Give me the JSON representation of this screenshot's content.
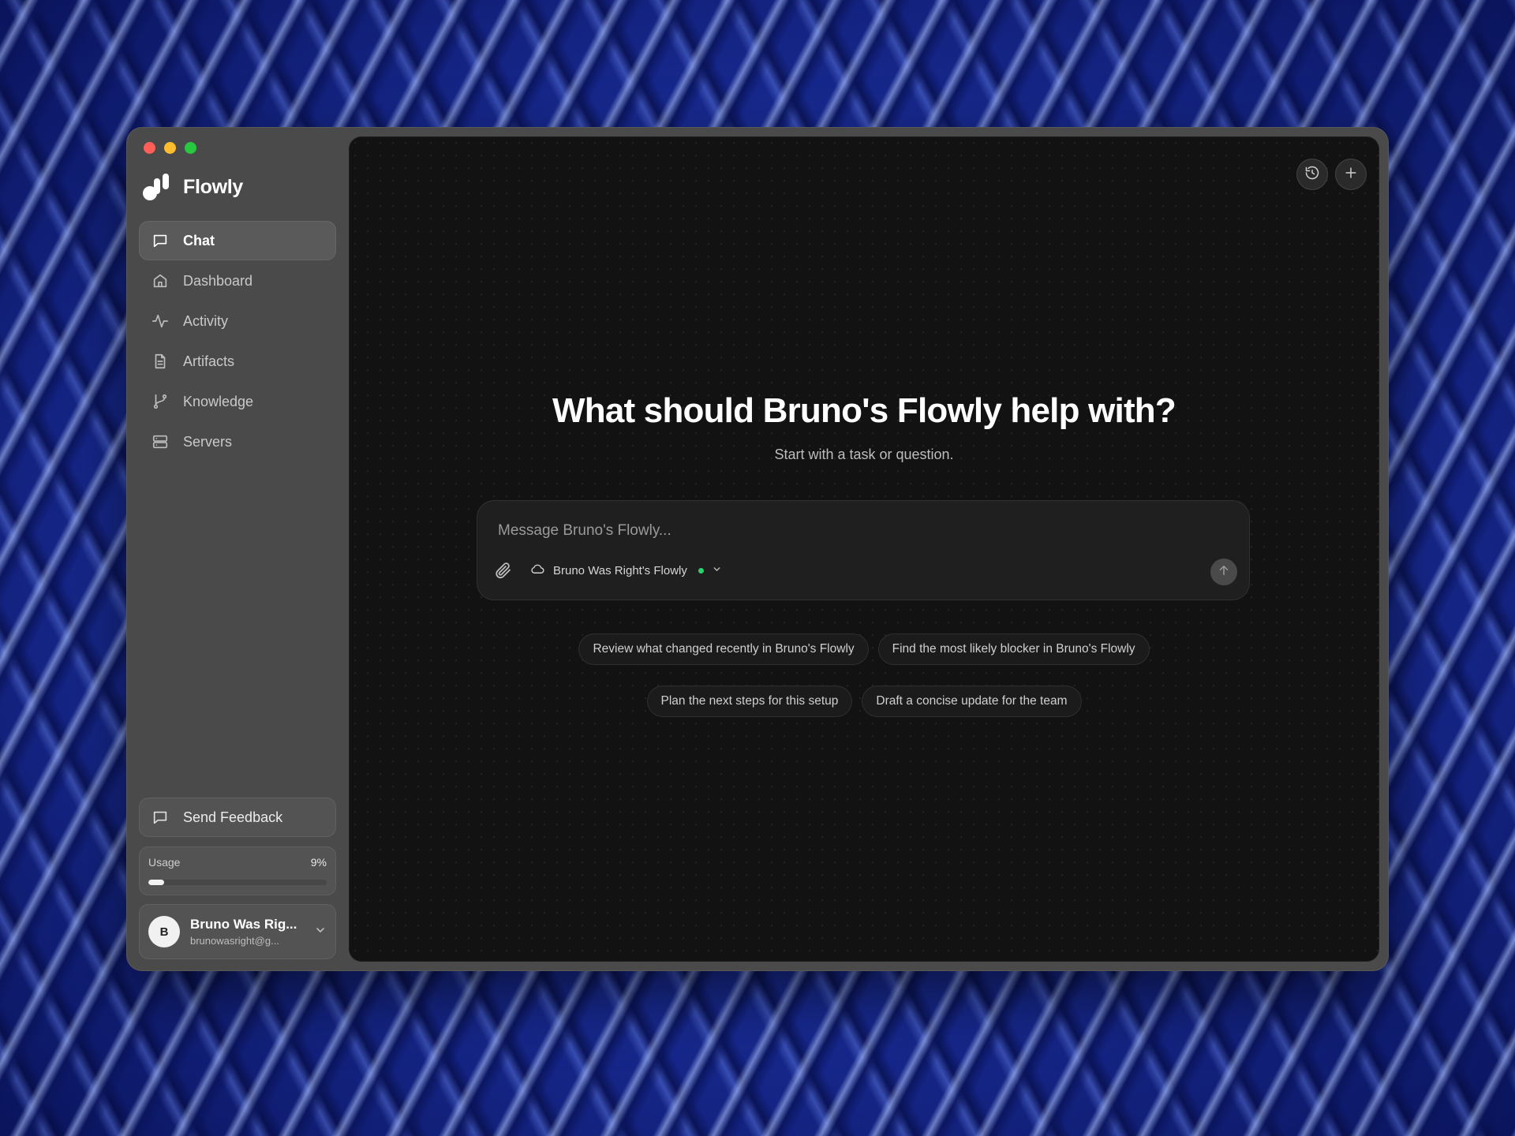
{
  "app": {
    "name": "Flowly"
  },
  "sidebar": {
    "items": [
      {
        "label": "Chat",
        "icon": "chat-icon",
        "active": true
      },
      {
        "label": "Dashboard",
        "icon": "home-icon"
      },
      {
        "label": "Activity",
        "icon": "activity-icon"
      },
      {
        "label": "Artifacts",
        "icon": "document-icon"
      },
      {
        "label": "Knowledge",
        "icon": "git-branch-icon"
      },
      {
        "label": "Servers",
        "icon": "server-icon"
      }
    ],
    "feedback_label": "Send Feedback",
    "usage": {
      "label": "Usage",
      "percent_text": "9%",
      "fraction": 0.09
    },
    "account": {
      "initial": "B",
      "name": "Bruno Was Rig...",
      "email": "brunowasright@g..."
    }
  },
  "main": {
    "title": "What should Bruno's Flowly help with?",
    "subtitle": "Start with a task or question.",
    "composer": {
      "placeholder": "Message Bruno's Flowly...",
      "workspace": "Bruno Was Right's Flowly",
      "workspace_status_color": "#2bd46a"
    },
    "suggestions": [
      "Review what changed recently in Bruno's Flowly",
      "Find the most likely blocker in Bruno's Flowly",
      "Plan the next steps for this setup",
      "Draft a concise update for the team"
    ]
  },
  "colors": {
    "accent_status": "#2bd46a",
    "window_bg": "#4a4a4a",
    "main_bg": "#121212"
  }
}
